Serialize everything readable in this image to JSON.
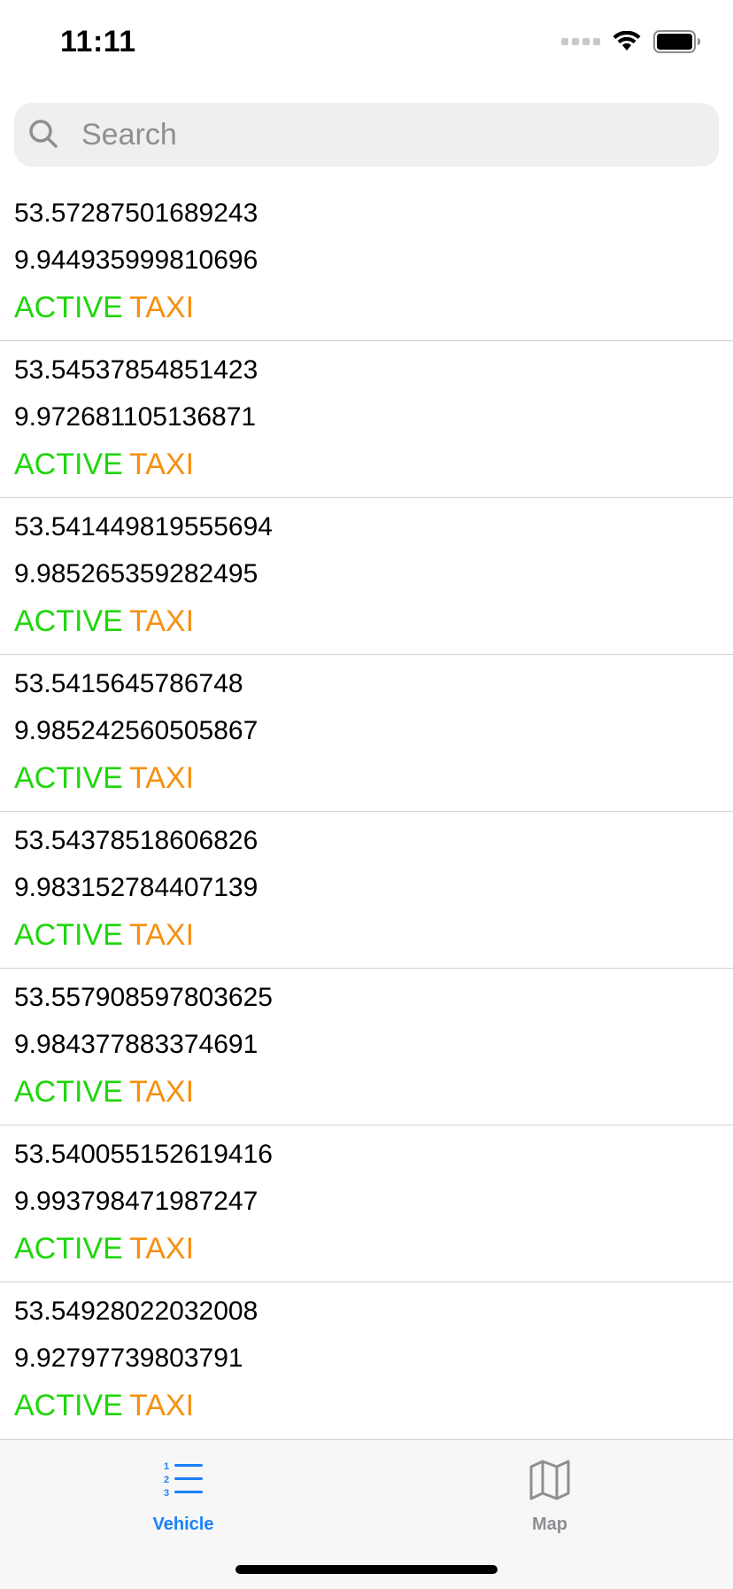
{
  "status_bar": {
    "time": "11:11"
  },
  "search": {
    "placeholder": "Search",
    "value": ""
  },
  "vehicles": [
    {
      "lat": "53.57287501689243",
      "lng": "9.944935999810696",
      "state": "ACTIVE",
      "type": "TAXI"
    },
    {
      "lat": "53.54537854851423",
      "lng": "9.972681105136871",
      "state": "ACTIVE",
      "type": "TAXI"
    },
    {
      "lat": "53.541449819555694",
      "lng": "9.985265359282495",
      "state": "ACTIVE",
      "type": "TAXI"
    },
    {
      "lat": "53.5415645786748",
      "lng": "9.985242560505867",
      "state": "ACTIVE",
      "type": "TAXI"
    },
    {
      "lat": "53.54378518606826",
      "lng": "9.983152784407139",
      "state": "ACTIVE",
      "type": "TAXI"
    },
    {
      "lat": "53.557908597803625",
      "lng": "9.984377883374691",
      "state": "ACTIVE",
      "type": "TAXI"
    },
    {
      "lat": "53.540055152619416",
      "lng": "9.993798471987247",
      "state": "ACTIVE",
      "type": "TAXI"
    },
    {
      "lat": "53.54928022032008",
      "lng": "9.92797739803791",
      "state": "ACTIVE",
      "type": "TAXI"
    }
  ],
  "tabs": [
    {
      "label": "Vehicle",
      "icon": "numbered-list-icon",
      "selected": true
    },
    {
      "label": "Map",
      "icon": "map-icon",
      "selected": false
    }
  ],
  "colors": {
    "state_active": "#1ed60a",
    "type_taxi": "#f5900f",
    "tab_selected": "#1a82f7",
    "tab_unselected": "#8e8e93"
  }
}
